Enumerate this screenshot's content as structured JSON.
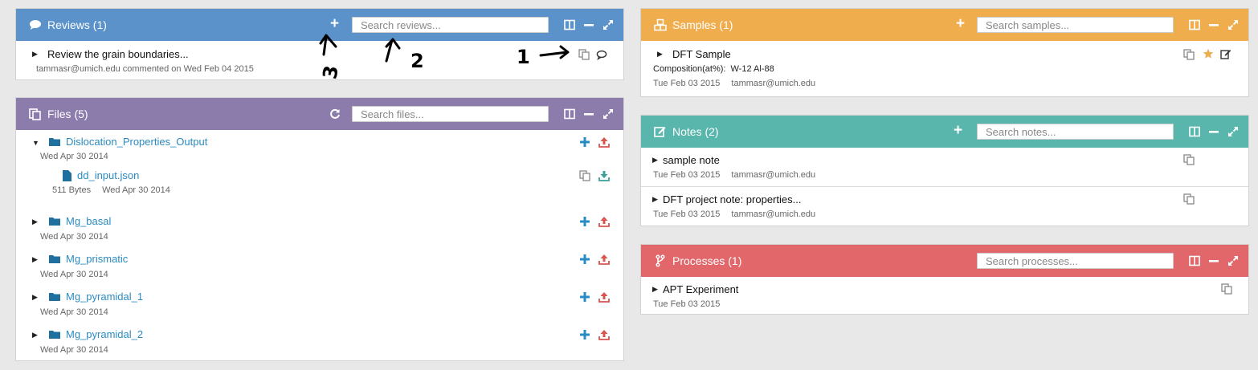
{
  "colors": {
    "reviews": "#5b92c9",
    "files": "#8c7cac",
    "samples": "#efad4e",
    "notes": "#58b6ad",
    "processes": "#e1676b",
    "link": "#2a8bc2",
    "upload": "#d9534f",
    "download": "#37a19a",
    "star": "#f0ad4e"
  },
  "reviews": {
    "title": "Reviews (1)",
    "search_placeholder": "Search reviews...",
    "items": [
      {
        "title": "Review the grain boundaries...",
        "meta": "tammasr@umich.edu commented on Wed Feb 04 2015"
      }
    ]
  },
  "files": {
    "title": "Files (5)",
    "search_placeholder": "Search files...",
    "items": [
      {
        "name": "Dislocation_Properties_Output",
        "date": "Wed Apr 30 2014",
        "expanded": true,
        "children": [
          {
            "name": "dd_input.json",
            "size": "511 Bytes",
            "date": "Wed Apr 30 2014"
          }
        ]
      },
      {
        "name": "Mg_basal",
        "date": "Wed Apr 30 2014"
      },
      {
        "name": "Mg_prismatic",
        "date": "Wed Apr 30 2014"
      },
      {
        "name": "Mg_pyramidal_1",
        "date": "Wed Apr 30 2014"
      },
      {
        "name": "Mg_pyramidal_2",
        "date": "Wed Apr 30 2014"
      }
    ]
  },
  "samples": {
    "title": "Samples (1)",
    "search_placeholder": "Search samples...",
    "items": [
      {
        "title": "DFT Sample",
        "composition_label": "Composition(at%):",
        "composition_value": "W-12 Al-88",
        "date": "Tue Feb 03 2015",
        "owner": "tammasr@umich.edu"
      }
    ]
  },
  "notes": {
    "title": "Notes (2)",
    "search_placeholder": "Search notes...",
    "items": [
      {
        "title": "sample note",
        "date": "Tue Feb 03 2015",
        "owner": "tammasr@umich.edu"
      },
      {
        "title": "DFT project note: properties...",
        "date": "Tue Feb 03 2015",
        "owner": "tammasr@umich.edu"
      }
    ]
  },
  "processes": {
    "title": "Processes (1)",
    "search_placeholder": "Search processes...",
    "items": [
      {
        "title": "APT Experiment",
        "date": "Tue Feb 03 2015"
      }
    ]
  },
  "annotations": [
    "1",
    "2",
    "3"
  ]
}
